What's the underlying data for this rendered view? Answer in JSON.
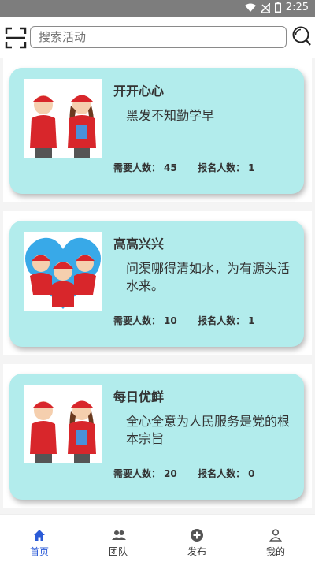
{
  "status": {
    "time": "2:25"
  },
  "search": {
    "placeholder": "搜索活动"
  },
  "activities": [
    {
      "title": "开开心心",
      "description": "黑发不知勤学早",
      "need_label": "需要人数：",
      "need": "45",
      "signed_label": "报名人数：",
      "signed": "1"
    },
    {
      "title": "高高兴兴",
      "description": "问渠哪得清如水，为有源头活水来。",
      "need_label": "需要人数：",
      "need": "10",
      "signed_label": "报名人数：",
      "signed": "1"
    },
    {
      "title": "每日优鲜",
      "description": "全心全意为人民服务是党的根本宗旨",
      "need_label": "需要人数：",
      "need": "20",
      "signed_label": "报名人数：",
      "signed": "0"
    }
  ],
  "tabs": [
    {
      "label": "首页",
      "icon": "home-icon",
      "active": true
    },
    {
      "label": "团队",
      "icon": "team-icon",
      "active": false
    },
    {
      "label": "发布",
      "icon": "publish-icon",
      "active": false
    },
    {
      "label": "我的",
      "icon": "profile-icon",
      "active": false
    }
  ],
  "colors": {
    "card": "#b2ecec",
    "accent": "#2b5bd7",
    "statusbar": "#7d7d7d"
  }
}
